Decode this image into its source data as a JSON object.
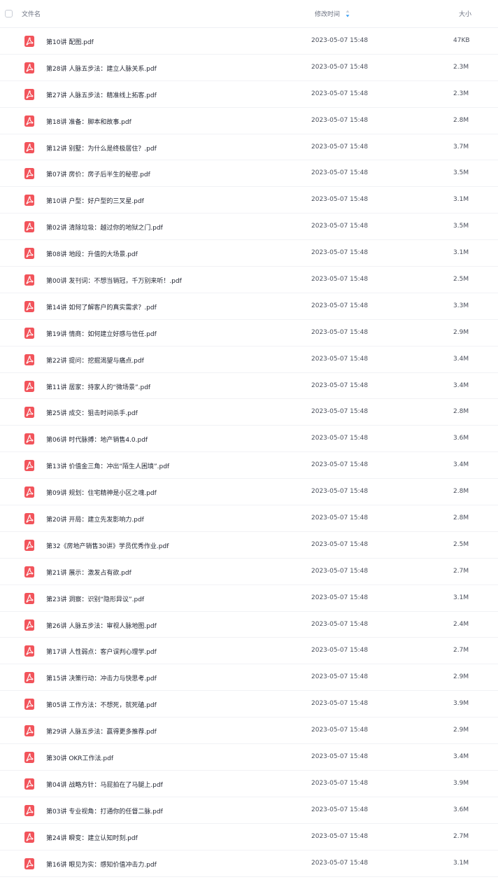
{
  "header": {
    "name_label": "文件名",
    "time_label": "修改时间",
    "size_label": "大小",
    "sort_icon": "sort-desc-icon"
  },
  "colors": {
    "pdf_icon": "#f2545b",
    "sort_accent": "#3aa0f3"
  },
  "files": [
    {
      "name": "第10讲 配图.pdf",
      "time": "2023-05-07 15:48",
      "size": "47KB",
      "icon": "pdf-icon"
    },
    {
      "name": "第28讲 人脉五步法：建立人脉关系.pdf",
      "time": "2023-05-07 15:48",
      "size": "2.3M",
      "icon": "pdf-icon"
    },
    {
      "name": "第27讲 人脉五步法：精准线上拓客.pdf",
      "time": "2023-05-07 15:48",
      "size": "2.3M",
      "icon": "pdf-icon"
    },
    {
      "name": "第18讲 准备：脚本和故事.pdf",
      "time": "2023-05-07 15:48",
      "size": "2.8M",
      "icon": "pdf-icon"
    },
    {
      "name": "第12讲 别墅：为什么是终极居住？.pdf",
      "time": "2023-05-07 15:48",
      "size": "3.7M",
      "icon": "pdf-icon"
    },
    {
      "name": "第07讲 房价：房子后半生的秘密.pdf",
      "time": "2023-05-07 15:48",
      "size": "3.5M",
      "icon": "pdf-icon"
    },
    {
      "name": "第10讲 户型：好户型的三叉星.pdf",
      "time": "2023-05-07 15:48",
      "size": "3.1M",
      "icon": "pdf-icon"
    },
    {
      "name": "第02讲 清除垃圾：越过你的地狱之门.pdf",
      "time": "2023-05-07 15:48",
      "size": "3.5M",
      "icon": "pdf-icon"
    },
    {
      "name": "第08讲 地段：升值的大场景.pdf",
      "time": "2023-05-07 15:48",
      "size": "3.1M",
      "icon": "pdf-icon"
    },
    {
      "name": "第00讲 发刊词：不想当销冠，千万别来听！.pdf",
      "time": "2023-05-07 15:48",
      "size": "2.5M",
      "icon": "pdf-icon"
    },
    {
      "name": "第14讲 如何了解客户的真实需求？.pdf",
      "time": "2023-05-07 15:48",
      "size": "3.3M",
      "icon": "pdf-icon"
    },
    {
      "name": "第19讲 情商：如何建立好感与信任.pdf",
      "time": "2023-05-07 15:48",
      "size": "2.9M",
      "icon": "pdf-icon"
    },
    {
      "name": "第22讲 提问：挖掘渴望与痛点.pdf",
      "time": "2023-05-07 15:48",
      "size": "3.4M",
      "icon": "pdf-icon"
    },
    {
      "name": "第11讲 居家：持家人的“微场景”.pdf",
      "time": "2023-05-07 15:48",
      "size": "3.4M",
      "icon": "pdf-icon"
    },
    {
      "name": "第25讲 成交：狙击时间杀手.pdf",
      "time": "2023-05-07 15:48",
      "size": "2.8M",
      "icon": "pdf-icon"
    },
    {
      "name": "第06讲 时代脉搏：地产销售4.0.pdf",
      "time": "2023-05-07 15:48",
      "size": "3.6M",
      "icon": "pdf-icon"
    },
    {
      "name": "第13讲 价值金三角：冲出“陌生人困境”.pdf",
      "time": "2023-05-07 15:48",
      "size": "3.4M",
      "icon": "pdf-icon"
    },
    {
      "name": "第09讲 规划：住宅精神是小区之魂.pdf",
      "time": "2023-05-07 15:48",
      "size": "2.8M",
      "icon": "pdf-icon"
    },
    {
      "name": "第20讲 开局：建立先发影响力.pdf",
      "time": "2023-05-07 15:48",
      "size": "2.8M",
      "icon": "pdf-icon"
    },
    {
      "name": "第32《房地产销售30讲》学员优秀作业.pdf",
      "time": "2023-05-07 15:48",
      "size": "2.5M",
      "icon": "pdf-icon"
    },
    {
      "name": "第21讲 展示：激发占有欲.pdf",
      "time": "2023-05-07 15:48",
      "size": "2.7M",
      "icon": "pdf-icon"
    },
    {
      "name": "第23讲 洞察：识别“隐形异议”.pdf",
      "time": "2023-05-07 15:48",
      "size": "3.1M",
      "icon": "pdf-icon"
    },
    {
      "name": "第26讲 人脉五步法：审视人脉地图.pdf",
      "time": "2023-05-07 15:48",
      "size": "2.4M",
      "icon": "pdf-icon"
    },
    {
      "name": "第17讲 人性弱点：客户误判心理学.pdf",
      "time": "2023-05-07 15:48",
      "size": "2.7M",
      "icon": "pdf-icon"
    },
    {
      "name": "第15讲 决策行动：冲击力与快思考.pdf",
      "time": "2023-05-07 15:48",
      "size": "2.9M",
      "icon": "pdf-icon"
    },
    {
      "name": "第05讲 工作方法：不想死，就死磕.pdf",
      "time": "2023-05-07 15:48",
      "size": "3.9M",
      "icon": "pdf-icon"
    },
    {
      "name": "第29讲 人脉五步法：赢得更多推荐.pdf",
      "time": "2023-05-07 15:48",
      "size": "2.9M",
      "icon": "pdf-icon"
    },
    {
      "name": "第30讲 OKR工作法.pdf",
      "time": "2023-05-07 15:48",
      "size": "3.4M",
      "icon": "pdf-icon"
    },
    {
      "name": "第04讲 战略方针：马屁拍在了马腿上.pdf",
      "time": "2023-05-07 15:48",
      "size": "3.9M",
      "icon": "pdf-icon"
    },
    {
      "name": "第03讲 专业视角：打通你的任督二脉.pdf",
      "time": "2023-05-07 15:48",
      "size": "3.6M",
      "icon": "pdf-icon"
    },
    {
      "name": "第24讲 瞬变：建立认知时刻.pdf",
      "time": "2023-05-07 15:48",
      "size": "2.7M",
      "icon": "pdf-icon"
    },
    {
      "name": "第16讲 眼见为实：感知价值冲击力.pdf",
      "time": "2023-05-07 15:48",
      "size": "3.1M",
      "icon": "pdf-icon"
    }
  ]
}
